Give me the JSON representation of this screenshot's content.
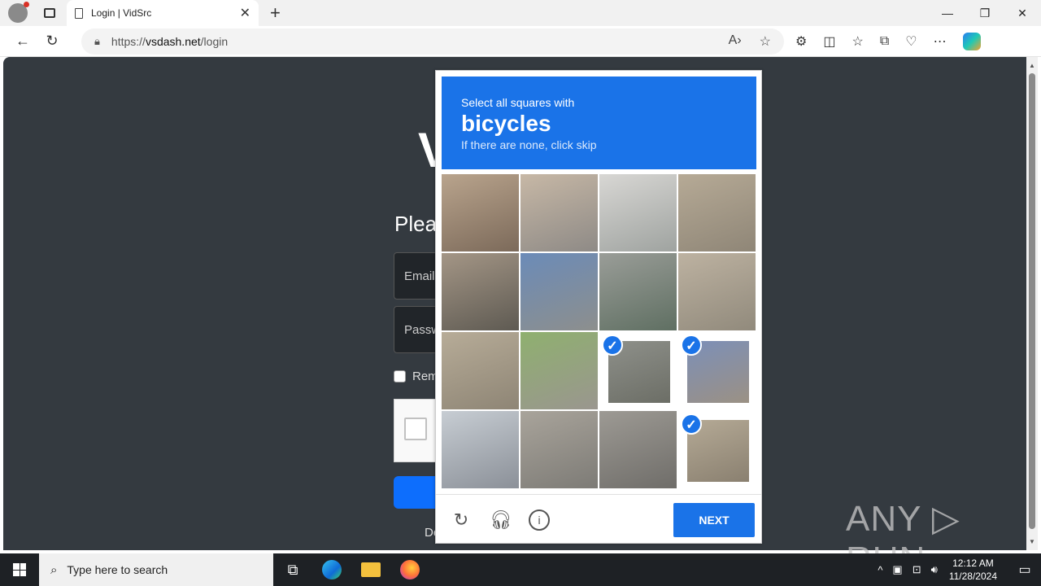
{
  "browser": {
    "tab_title": "Login | VidSrc",
    "tab_close": "✕",
    "new_tab": "+",
    "url_scheme": "https://",
    "url_host": "vsdash.net",
    "url_path": "/login",
    "window_controls": [
      "—",
      "❐",
      "✕"
    ]
  },
  "page": {
    "logo_fragment": "V",
    "heading_fragment": "Plea",
    "email_fragment": "Email",
    "password_fragment": "Passw",
    "remember_fragment": "Rem",
    "link_fragment": "De"
  },
  "captcha": {
    "instruction": "Select all squares with",
    "target": "bicycles",
    "hint": "If there are none, click skip",
    "next_label": "NEXT",
    "tiles": [
      {
        "selected": false
      },
      {
        "selected": false
      },
      {
        "selected": false
      },
      {
        "selected": false
      },
      {
        "selected": false
      },
      {
        "selected": false
      },
      {
        "selected": false
      },
      {
        "selected": false
      },
      {
        "selected": false
      },
      {
        "selected": false
      },
      {
        "selected": true
      },
      {
        "selected": true
      },
      {
        "selected": false
      },
      {
        "selected": false
      },
      {
        "selected": false
      },
      {
        "selected": true
      }
    ],
    "footer_icons": [
      "reload-icon",
      "audio-headphones-icon",
      "info-icon"
    ]
  },
  "watermark": "ANY ▷ RUN",
  "taskbar": {
    "search_placeholder": "Type here to search",
    "time": "12:12 AM",
    "date": "11/28/2024"
  }
}
